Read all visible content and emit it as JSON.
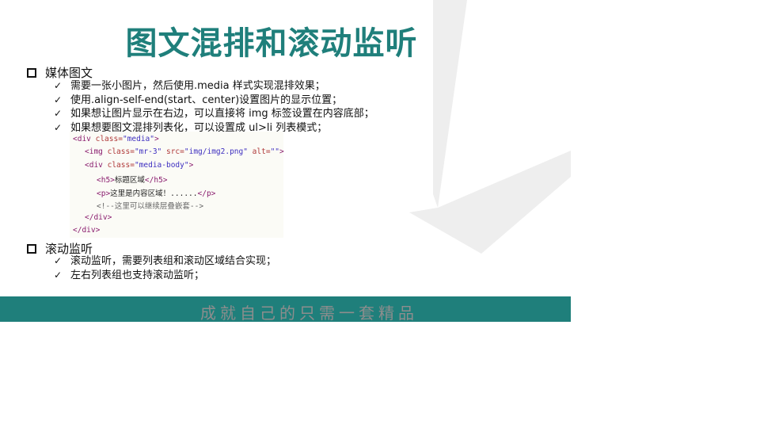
{
  "slide": {
    "title": "图文混排和滚动监听",
    "sections": [
      {
        "heading": "媒体图文",
        "bullets": [
          "需要一张小图片，然后使用.media 样式实现混排效果；",
          "使用.align-self-end(start、center)设置图片的显示位置；",
          "如果想让图片显示在右边，可以直接将 img 标签设置在内容底部；",
          "如果想要图文混排列表化，可以设置成 ul>li 列表模式；"
        ]
      },
      {
        "heading": "滚动监听",
        "bullets": [
          "滚动监听，需要列表组和滚动区域结合实现；",
          "左右列表组也支持滚动监听；"
        ]
      }
    ],
    "code": {
      "line1": {
        "open": "<div ",
        "a1": "class=",
        "v1": "\"media\"",
        "close": ">"
      },
      "line2": {
        "open": "<img ",
        "a1": "class=",
        "v1": "\"mr-3\"",
        "a2": " src=",
        "v2": "\"img/img2.png\"",
        "a3": " alt=",
        "v3": "\"\"",
        "close": ">"
      },
      "line3": {
        "open": "<div ",
        "a1": "class=",
        "v1": "\"media-body\"",
        "close": ">"
      },
      "line4": {
        "open": "<h5>",
        "text": "标题区域",
        "close": "</h5>"
      },
      "line5": {
        "open": "<p>",
        "text": "这里是内容区域！......",
        "close": "</p>"
      },
      "line6": "<!--这里可以继续层叠嵌套-->",
      "line7": "</div>",
      "line8": "</div>"
    },
    "check_glyph": "✓",
    "footer_text": "成就自己的只需一套精品"
  },
  "colors": {
    "accent": "#1f7f7b",
    "footer_text": "#8d8d8d",
    "deco_gray": "#eeeeee"
  }
}
